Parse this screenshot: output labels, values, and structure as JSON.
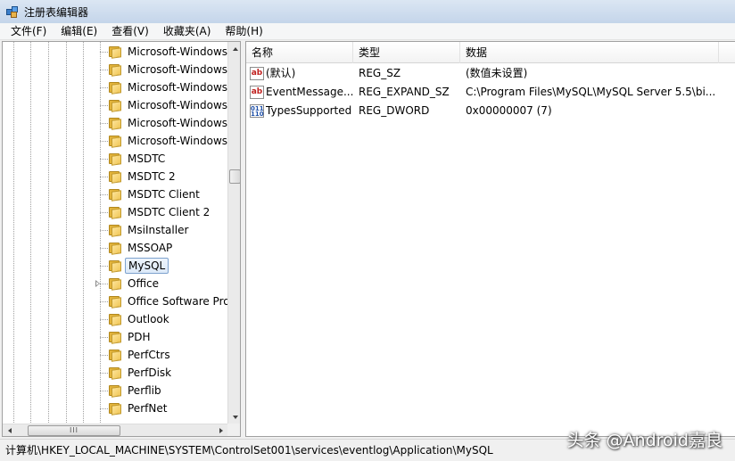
{
  "window": {
    "title": "注册表编辑器"
  },
  "menu": [
    "文件(F)",
    "编辑(E)",
    "查看(V)",
    "收藏夹(A)",
    "帮助(H)"
  ],
  "tree": {
    "items": [
      {
        "label": "Microsoft-Windows",
        "expandable": false,
        "selected": false
      },
      {
        "label": "Microsoft-Windows",
        "expandable": false,
        "selected": false
      },
      {
        "label": "Microsoft-Windows",
        "expandable": false,
        "selected": false
      },
      {
        "label": "Microsoft-Windows",
        "expandable": false,
        "selected": false
      },
      {
        "label": "Microsoft-Windows",
        "expandable": false,
        "selected": false
      },
      {
        "label": "Microsoft-Windows",
        "expandable": false,
        "selected": false
      },
      {
        "label": "MSDTC",
        "expandable": false,
        "selected": false
      },
      {
        "label": "MSDTC 2",
        "expandable": false,
        "selected": false
      },
      {
        "label": "MSDTC Client",
        "expandable": false,
        "selected": false
      },
      {
        "label": "MSDTC Client 2",
        "expandable": false,
        "selected": false
      },
      {
        "label": "MsiInstaller",
        "expandable": false,
        "selected": false
      },
      {
        "label": "MSSOAP",
        "expandable": false,
        "selected": false
      },
      {
        "label": "MySQL",
        "expandable": false,
        "selected": true
      },
      {
        "label": "Office",
        "expandable": true,
        "selected": false
      },
      {
        "label": "Office Software Pro",
        "expandable": false,
        "selected": false
      },
      {
        "label": "Outlook",
        "expandable": false,
        "selected": false
      },
      {
        "label": "PDH",
        "expandable": false,
        "selected": false
      },
      {
        "label": "PerfCtrs",
        "expandable": false,
        "selected": false
      },
      {
        "label": "PerfDisk",
        "expandable": false,
        "selected": false
      },
      {
        "label": "Perflib",
        "expandable": false,
        "selected": false
      },
      {
        "label": "PerfNet",
        "expandable": false,
        "selected": false
      }
    ],
    "hscroll_grip": "III"
  },
  "values": {
    "columns": [
      "名称",
      "类型",
      "数据"
    ],
    "rows": [
      {
        "icon": "ab",
        "icon_name": "string-value-icon",
        "name": "(默认)",
        "type": "REG_SZ",
        "data": "(数值未设置)"
      },
      {
        "icon": "ab",
        "icon_name": "string-value-icon",
        "name": "EventMessage...",
        "type": "REG_EXPAND_SZ",
        "data": "C:\\Program Files\\MySQL\\MySQL Server 5.5\\bi..."
      },
      {
        "icon": "011\n110",
        "icon_name": "binary-value-icon",
        "name": "TypesSupported",
        "type": "REG_DWORD",
        "data": "0x00000007 (7)"
      }
    ]
  },
  "status": {
    "path": "计算机\\HKEY_LOCAL_MACHINE\\SYSTEM\\ControlSet001\\services\\eventlog\\Application\\MySQL"
  },
  "watermark": "头条 @Android嘉良"
}
